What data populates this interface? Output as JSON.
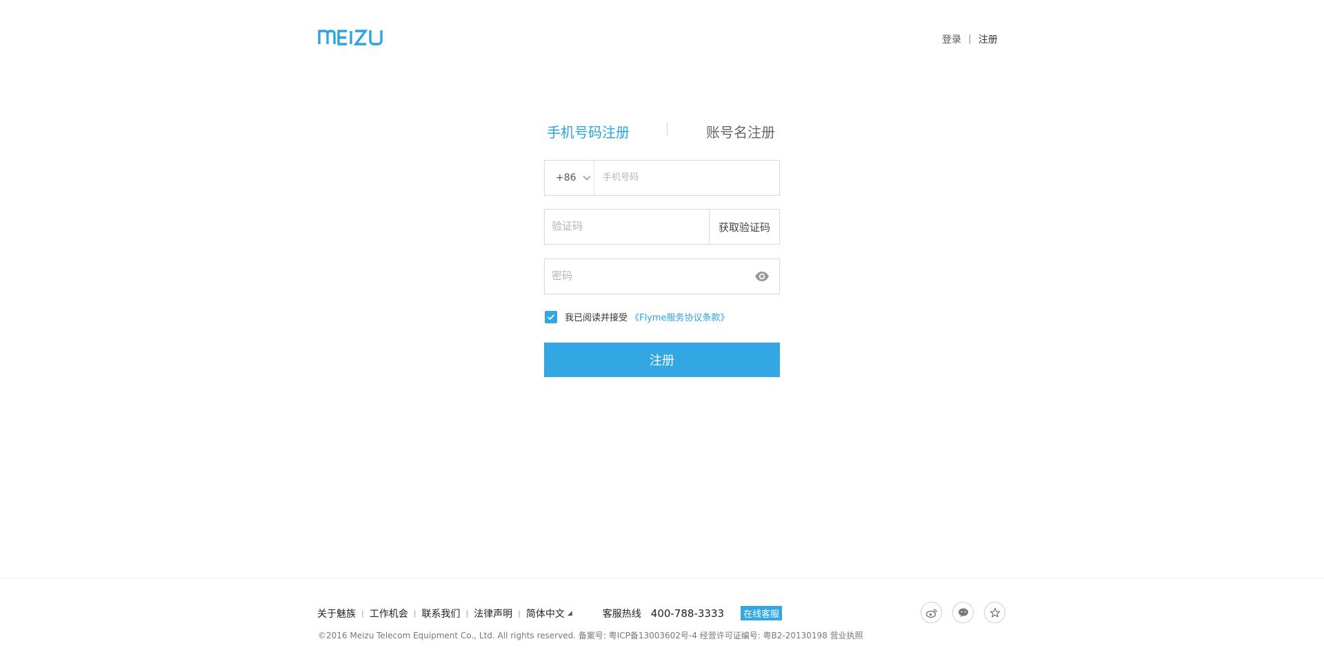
{
  "header": {
    "logo_text": "MEIZU",
    "login_label": "登录",
    "separator": "|",
    "register_label": "注册"
  },
  "tabs": {
    "phone_register": "手机号码注册",
    "account_register": "账号名注册"
  },
  "form": {
    "country_code": "+86",
    "phone_placeholder": "手机号码",
    "code_placeholder": "验证码",
    "get_code_label": "获取验证码",
    "password_placeholder": "密码",
    "agree_text": "我已阅读并接受",
    "agree_link": "《Flyme服务协议条款》",
    "agree_checked": true,
    "submit_label": "注册"
  },
  "footer": {
    "links": [
      "关于魅族",
      "工作机会",
      "联系我们",
      "法律声明",
      "简体中文"
    ],
    "lang_arrow": "◢",
    "hotline_label": "客服热线",
    "hotline_number": "400-788-3333",
    "online_service": "在线客服",
    "copyright": "©2016 Meizu Telecom Equipment Co., Ltd. All rights reserved.  备案号: 粤ICP备13003602号-4  经营许可证编号: 粤B2-20130198  营业执照",
    "social_icons": [
      "weibo-icon",
      "wechat-icon",
      "star-icon"
    ]
  },
  "colors": {
    "accent": "#32a7e4",
    "link": "#29a5e0",
    "border": "#d9d9d9"
  }
}
